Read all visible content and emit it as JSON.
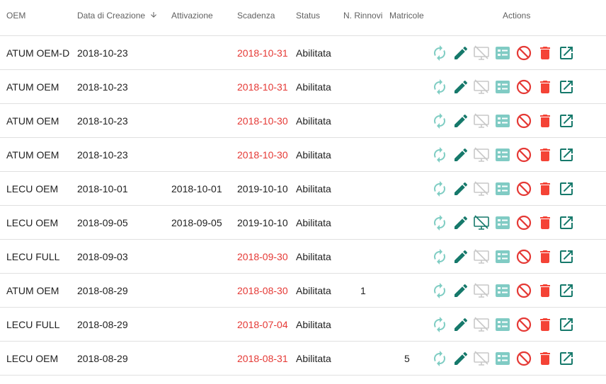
{
  "colors": {
    "renew": "#7fcdc3",
    "edit": "#16796b",
    "monitor_off": "#c8c8c8",
    "monitor_active": "#16796b",
    "list": "#80cbc4",
    "block": "#e53935",
    "delete": "#f44336",
    "open": "#16796b",
    "expired_text": "#e53935"
  },
  "icons": {
    "sort": "arrow-down-icon",
    "renew": "refresh-icon",
    "edit": "pencil-icon",
    "monitor": "monitor-off-icon",
    "list": "list-box-icon",
    "block": "block-icon",
    "delete": "trash-icon",
    "open": "open-in-new-icon"
  },
  "header": {
    "oem": "OEM",
    "data_creazione": "Data di Creazione",
    "attivazione": "Attivazione",
    "scadenza": "Scadenza",
    "status": "Status",
    "rinnovi": "N. Rinnovi",
    "matricole": "Matricole",
    "actions": "Actions"
  },
  "rows": [
    {
      "oem": "ATUM OEM-D",
      "created": "2018-10-23",
      "activation": "",
      "expiry": "2018-10-31",
      "expired": true,
      "status": "Abilitata",
      "renewals": "",
      "serials": "",
      "monitor_active": false
    },
    {
      "oem": "ATUM OEM",
      "created": "2018-10-23",
      "activation": "",
      "expiry": "2018-10-31",
      "expired": true,
      "status": "Abilitata",
      "renewals": "",
      "serials": "",
      "monitor_active": false
    },
    {
      "oem": "ATUM OEM",
      "created": "2018-10-23",
      "activation": "",
      "expiry": "2018-10-30",
      "expired": true,
      "status": "Abilitata",
      "renewals": "",
      "serials": "",
      "monitor_active": false
    },
    {
      "oem": "ATUM OEM",
      "created": "2018-10-23",
      "activation": "",
      "expiry": "2018-10-30",
      "expired": true,
      "status": "Abilitata",
      "renewals": "",
      "serials": "",
      "monitor_active": false
    },
    {
      "oem": "LECU OEM",
      "created": "2018-10-01",
      "activation": "2018-10-01",
      "expiry": "2019-10-10",
      "expired": false,
      "status": "Abilitata",
      "renewals": "",
      "serials": "",
      "monitor_active": false
    },
    {
      "oem": "LECU OEM",
      "created": "2018-09-05",
      "activation": "2018-09-05",
      "expiry": "2019-10-10",
      "expired": false,
      "status": "Abilitata",
      "renewals": "",
      "serials": "",
      "monitor_active": true
    },
    {
      "oem": "LECU FULL",
      "created": "2018-09-03",
      "activation": "",
      "expiry": "2018-09-30",
      "expired": true,
      "status": "Abilitata",
      "renewals": "",
      "serials": "",
      "monitor_active": false
    },
    {
      "oem": "ATUM OEM",
      "created": "2018-08-29",
      "activation": "",
      "expiry": "2018-08-30",
      "expired": true,
      "status": "Abilitata",
      "renewals": "1",
      "serials": "",
      "monitor_active": false
    },
    {
      "oem": "LECU FULL",
      "created": "2018-08-29",
      "activation": "",
      "expiry": "2018-07-04",
      "expired": true,
      "status": "Abilitata",
      "renewals": "",
      "serials": "",
      "monitor_active": false
    },
    {
      "oem": "LECU OEM",
      "created": "2018-08-29",
      "activation": "",
      "expiry": "2018-08-31",
      "expired": true,
      "status": "Abilitata",
      "renewals": "",
      "serials": "5",
      "monitor_active": false
    }
  ]
}
